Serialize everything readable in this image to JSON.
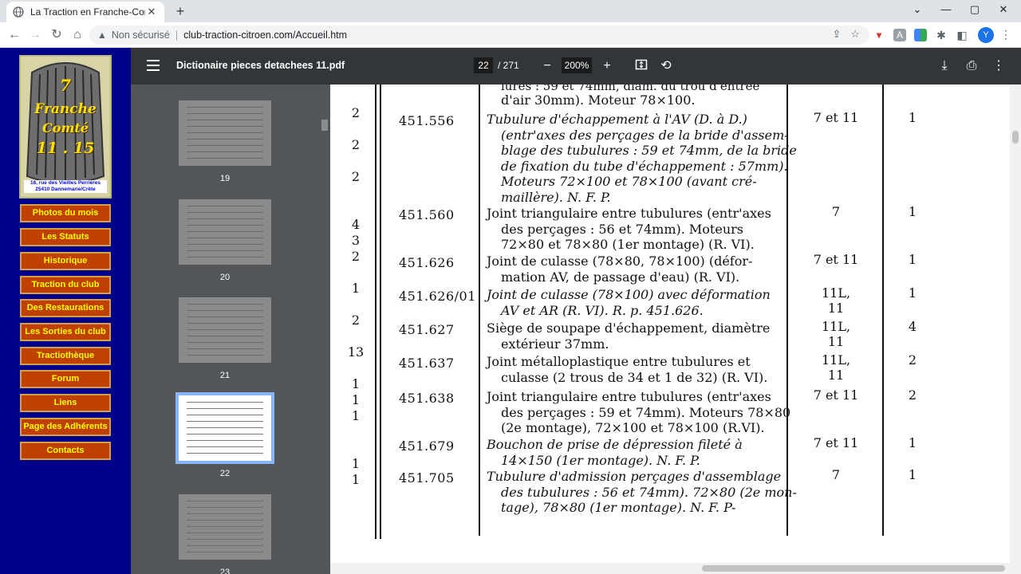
{
  "browser": {
    "tab_title": "La Traction en Franche-Comté",
    "security_label": "Non sécurisé",
    "url": "club-traction-citroen.com/Accueil.htm",
    "profile_initial": "Y"
  },
  "site": {
    "logo": {
      "number": "7",
      "line1": "Franche",
      "line2": "Comté",
      "line3": "11 . 15",
      "address1": "16, rue des Vieilles Perrières",
      "address2": "25410 Dannemarie/Crête"
    },
    "menu": [
      "Photos du mois",
      "Les Statuts",
      "Historique",
      "Traction du club",
      "Des Restaurations",
      "Les Sorties du club",
      "Tractiothèque",
      "Forum",
      "Liens",
      "Page des Adhérents",
      "Contacts"
    ],
    "colors": {
      "background": "#00008a",
      "button": "#c04000",
      "button_text": "#ffff00"
    }
  },
  "pdf": {
    "filename": "Dictionaire pieces detachees 11.pdf",
    "current_page": "22",
    "total_pages": "/ 271",
    "zoom": "200%",
    "thumbnails": [
      "19",
      "20",
      "21",
      "22",
      "23"
    ],
    "selected_thumbnail": "22"
  },
  "document": {
    "top_partial": "lures : 59 et 74mm, diam. du trou d'entrée",
    "top_line2": "d'air 30mm). Moteur 78×100.",
    "rows": [
      {
        "qty": [
          "2",
          "2",
          "2"
        ],
        "ref": "451.556",
        "lines": [
          "Tubulure d'échappement à l'AV (D. à D.)",
          "(entr'axes des perçages de la bride d'assem-",
          "blage des tubulures : 59 et 74mm, de la bride",
          "de fixation du tube d'échappement : 57mm).",
          "Moteurs 72×100 et 78×100 (avant cré-",
          "maillère). N. F. P."
        ],
        "italic": true,
        "type": "7 et 11",
        "count": "1"
      },
      {
        "qty": [
          "4",
          "3"
        ],
        "ref": "451.560",
        "lines": [
          "Joint triangulaire entre tubulures (entr'axes",
          "des perçages : 56 et 74mm). Moteurs",
          "72×80 et 78×80 (1er montage) (R. VI)."
        ],
        "italic": false,
        "type": "7",
        "count": "1"
      },
      {
        "qty": [
          "2"
        ],
        "ref": "451.626",
        "lines": [
          "Joint de culasse (78×80, 78×100) (défor-",
          "mation AV, de passage d'eau) (R. VI)."
        ],
        "italic": false,
        "type": "7 et 11",
        "count": "1"
      },
      {
        "qty": [
          "1"
        ],
        "ref": "451.626/01",
        "lines": [
          "Joint de culasse (78×100) avec déformation",
          "AV et AR (R. VI). R. p. 451.626."
        ],
        "italic": true,
        "type": "11L, 11",
        "count": "1"
      },
      {
        "qty": [
          "2"
        ],
        "ref": "451.627",
        "lines": [
          "Siège de soupape d'échappement, diamètre",
          "extérieur 37mm."
        ],
        "italic": false,
        "type": "11L, 11",
        "count": "4"
      },
      {
        "qty": [
          "13"
        ],
        "ref": "451.637",
        "lines": [
          "Joint métalloplastique entre tubulures et",
          "culasse (2 trous de 34 et 1 de 32) (R. VI)."
        ],
        "italic": false,
        "type": "11L, 11",
        "count": "2"
      },
      {
        "qty": [
          "1",
          "1",
          "1"
        ],
        "ref": "451.638",
        "lines": [
          "Joint triangulaire entre tubulures (entr'axes",
          "des perçages : 59 et 74mm). Moteurs 78×80",
          "(2e montage), 72×100 et 78×100 (R.VI)."
        ],
        "italic": false,
        "type": "7 et 11",
        "count": "2"
      },
      {
        "qty": [
          "1"
        ],
        "ref": "451.679",
        "lines": [
          "Bouchon de prise de dépression fileté à",
          "14×150 (1er montage). N. F. P."
        ],
        "italic": true,
        "type": "7 et 11",
        "count": "1"
      },
      {
        "qty": [
          "1"
        ],
        "ref": "451.705",
        "lines": [
          "Tubulure d'admission perçages d'assemblage",
          "des tubulures : 56 et 74mm). 72×80 (2e mon-",
          "tage), 78×80 (1er montage). N. F. P-"
        ],
        "italic": true,
        "type": "7",
        "count": "1"
      }
    ]
  }
}
